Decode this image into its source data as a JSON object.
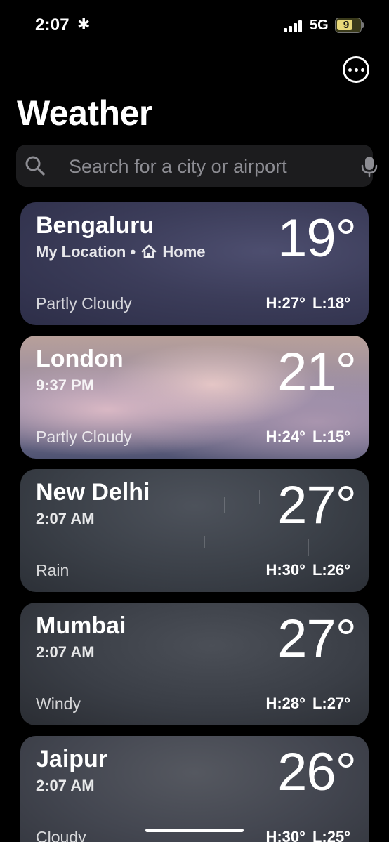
{
  "status_bar": {
    "time": "2:07",
    "focus_glyph": "✱",
    "network": "5G",
    "battery": "9"
  },
  "header": {
    "title": "Weather",
    "more_icon": "ellipsis-circle-icon"
  },
  "search": {
    "placeholder": "Search for a city or airport"
  },
  "cities": [
    {
      "name": "Bengaluru",
      "subtitle_prefix": "My Location •",
      "subtitle_home": "Home",
      "temp": "19°",
      "condition": "Partly Cloudy",
      "high": "H:27°",
      "low": "L:18°"
    },
    {
      "name": "London",
      "time": "9:37 PM",
      "temp": "21°",
      "condition": "Partly Cloudy",
      "high": "H:24°",
      "low": "L:15°"
    },
    {
      "name": "New Delhi",
      "time": "2:07 AM",
      "temp": "27°",
      "condition": "Rain",
      "high": "H:30°",
      "low": "L:26°"
    },
    {
      "name": "Mumbai",
      "time": "2:07 AM",
      "temp": "27°",
      "condition": "Windy",
      "high": "H:28°",
      "low": "L:27°"
    },
    {
      "name": "Jaipur",
      "time": "2:07 AM",
      "temp": "26°",
      "condition": "Cloudy",
      "high": "H:30°",
      "low": "L:25°"
    }
  ]
}
